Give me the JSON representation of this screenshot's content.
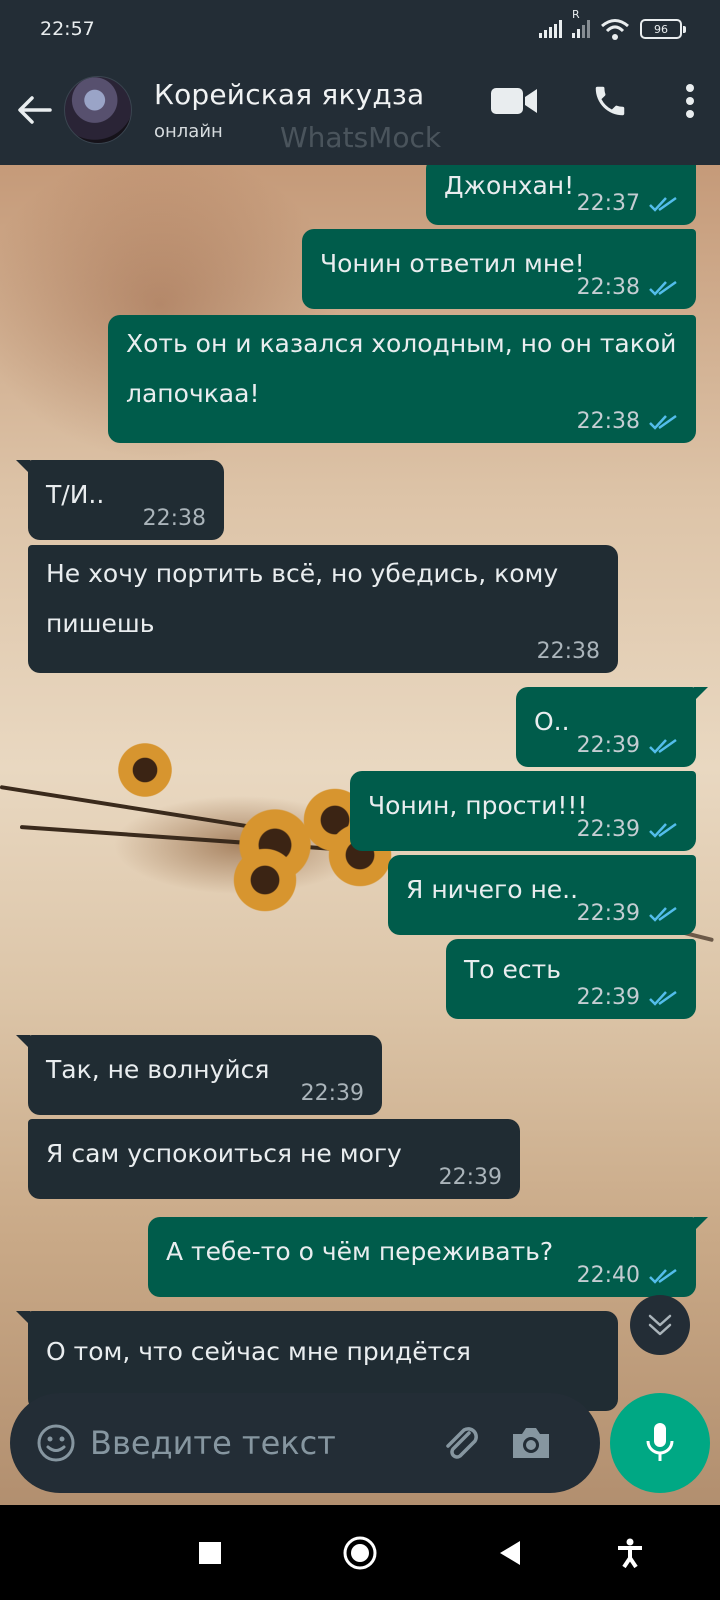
{
  "status_bar": {
    "time": "22:57",
    "signal_label": "R",
    "battery": "96"
  },
  "header": {
    "contact_name": "Корейская якудза",
    "contact_status": "онлайн",
    "watermark": "WhatsMock",
    "icons": [
      "back-arrow-icon",
      "video-call-icon",
      "phone-icon",
      "more-options-icon"
    ]
  },
  "messages": [
    {
      "direction": "out",
      "text": "Джонхан!",
      "time": "22:37",
      "read": true
    },
    {
      "direction": "out",
      "text": "Чонин ответил мне!",
      "time": "22:38",
      "read": true
    },
    {
      "direction": "out",
      "text": "Хоть он и казался холодным, но он такой лапочкаа!",
      "time": "22:38",
      "read": true
    },
    {
      "direction": "in",
      "text": "Т/И..",
      "time": "22:38"
    },
    {
      "direction": "in",
      "text": "Не хочу портить всё, но убедись, кому пишешь",
      "time": "22:38"
    },
    {
      "direction": "out",
      "text": "О..",
      "time": "22:39",
      "read": true
    },
    {
      "direction": "out",
      "text": "Чонин, прости!!!",
      "time": "22:39",
      "read": true
    },
    {
      "direction": "out",
      "text": "Я ничего не..",
      "time": "22:39",
      "read": true
    },
    {
      "direction": "out",
      "text": "То есть",
      "time": "22:39",
      "read": true
    },
    {
      "direction": "in",
      "text": "Так, не волнуйся",
      "time": "22:39"
    },
    {
      "direction": "in",
      "text": "Я сам успокоиться не могу",
      "time": "22:39"
    },
    {
      "direction": "out",
      "text": "А тебе-то о чём переживать?",
      "time": "22:40",
      "read": true
    },
    {
      "direction": "in",
      "text": "О том, что сейчас мне придётся",
      "time": ""
    }
  ],
  "input": {
    "placeholder": "Введите текст",
    "value": ""
  },
  "colors": {
    "header_bg": "#232d36",
    "outgoing_bubble": "#005c4b",
    "incoming_bubble": "#202c33",
    "read_ticks": "#53bdeb",
    "mic_button": "#00a884"
  }
}
